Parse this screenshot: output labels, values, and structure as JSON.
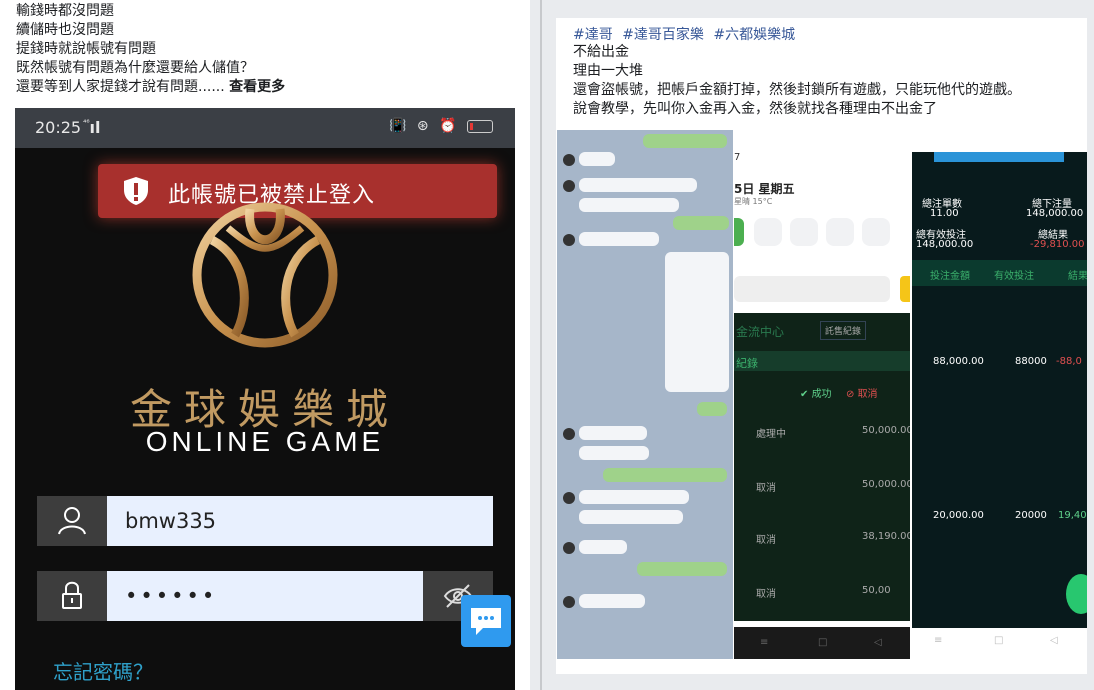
{
  "left_post": {
    "lines": [
      "輸錢時都沒問題",
      "續儲時也沒問題",
      "提錢時就說帳號有問題",
      "既然帳號有問題為什麼還要給人儲值？",
      "還要等到人家提錢才說有問題......"
    ],
    "see_more": "查看更多"
  },
  "phone": {
    "status_time": "20:25",
    "status_net": "⁴⁶",
    "signal": "ıl",
    "status_icons": "📳 ⊛ ⏰",
    "alert_text": "此帳號已被禁止登入",
    "brand_cn": "金球娛樂城",
    "brand_en": "ONLINE GAME",
    "username_value": "bmw335",
    "password_value": "••••••",
    "forgot_password": "忘記密碼？"
  },
  "right_post": {
    "hashtags": [
      "#達哥",
      "#達哥百家樂",
      "#六都娛樂城"
    ],
    "lines": [
      "不給出金",
      "理由一大堆",
      "還會盜帳號，把帳戶金額打掉，然後封鎖所有遊戲，只能玩他代的遊戲。",
      "說會教學，先叫你入金再入金，然後就找各種理由不出金了"
    ]
  },
  "screenshot2": {
    "date": "5日 星期五",
    "weather": "星晴 15°C",
    "center": "金流中心",
    "record_btn": "託售紀錄",
    "records": "紀錄",
    "success": "成功",
    "cancel": "取消",
    "rows": [
      {
        "status": "處理中",
        "amount": "50,000.00"
      },
      {
        "status": "取消",
        "amount": "50,000.00"
      },
      {
        "status": "取消",
        "amount": "38,190.00"
      },
      {
        "status": "取消",
        "amount": "50,00"
      }
    ]
  },
  "screenshot3": {
    "total_bets_label": "總注單數",
    "total_bets": "11.00",
    "total_wager_label": "總下注量",
    "total_wager": "148,000.00",
    "effective_label": "總有效投注",
    "effective": "148,000.00",
    "result_label": "總結果",
    "result": "-29,810.00",
    "col1": "投注金額",
    "col2": "有效投注",
    "col3": "結果",
    "rows": [
      {
        "bet": "88,000.00",
        "effective": "88000",
        "result": "-88,0"
      },
      {
        "bet": "20,000.00",
        "effective": "20000",
        "result": "19,40"
      }
    ]
  }
}
